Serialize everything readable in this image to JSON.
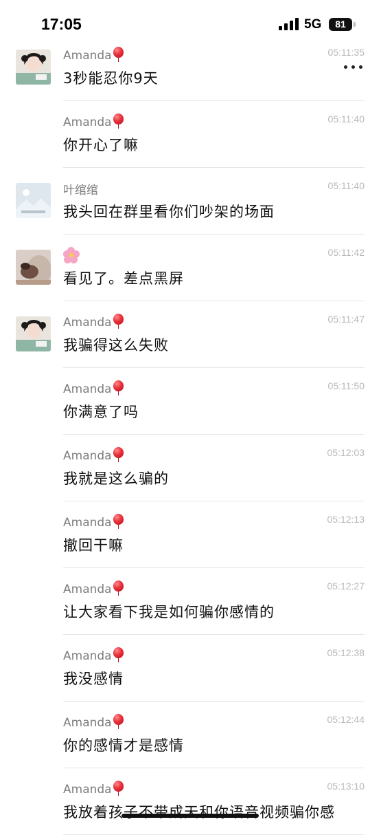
{
  "status_bar": {
    "time": "17:05",
    "network": "5G",
    "battery": "81"
  },
  "toolbar": {
    "more_icon": "more-dots-icon"
  },
  "messages": [
    {
      "sender": "Amanda",
      "badge": "balloon",
      "avatar": "girl-photo",
      "time": "05:11:35",
      "text": "3秒能忍你9天"
    },
    {
      "sender": "Amanda",
      "badge": "balloon",
      "avatar": "",
      "time": "05:11:40",
      "text": "你开心了嘛"
    },
    {
      "sender": "叶绾绾",
      "badge": "",
      "avatar": "placeholder-image",
      "time": "05:11:40",
      "text": "我头回在群里看你们吵架的场面"
    },
    {
      "sender": "",
      "badge": "flower",
      "avatar": "dog-photo",
      "time": "05:11:42",
      "text": "看见了。差点黑屏"
    },
    {
      "sender": "Amanda",
      "badge": "balloon",
      "avatar": "girl-photo",
      "time": "05:11:47",
      "text": "我骗得这么失败"
    },
    {
      "sender": "Amanda",
      "badge": "balloon",
      "avatar": "",
      "time": "05:11:50",
      "text": "你满意了吗"
    },
    {
      "sender": "Amanda",
      "badge": "balloon",
      "avatar": "",
      "time": "05:12:03",
      "text": "我就是这么骗的"
    },
    {
      "sender": "Amanda",
      "badge": "balloon",
      "avatar": "",
      "time": "05:12:13",
      "text": "撤回干嘛"
    },
    {
      "sender": "Amanda",
      "badge": "balloon",
      "avatar": "",
      "time": "05:12:27",
      "text": "让大家看下我是如何骗你感情的"
    },
    {
      "sender": "Amanda",
      "badge": "balloon",
      "avatar": "",
      "time": "05:12:38",
      "text": "我没感情"
    },
    {
      "sender": "Amanda",
      "badge": "balloon",
      "avatar": "",
      "time": "05:12:44",
      "text": "你的感情才是感情"
    },
    {
      "sender": "Amanda",
      "badge": "balloon",
      "avatar": "",
      "time": "05:13:10",
      "text": "我放着孩子不带成天和你语音视频骗你感"
    }
  ]
}
